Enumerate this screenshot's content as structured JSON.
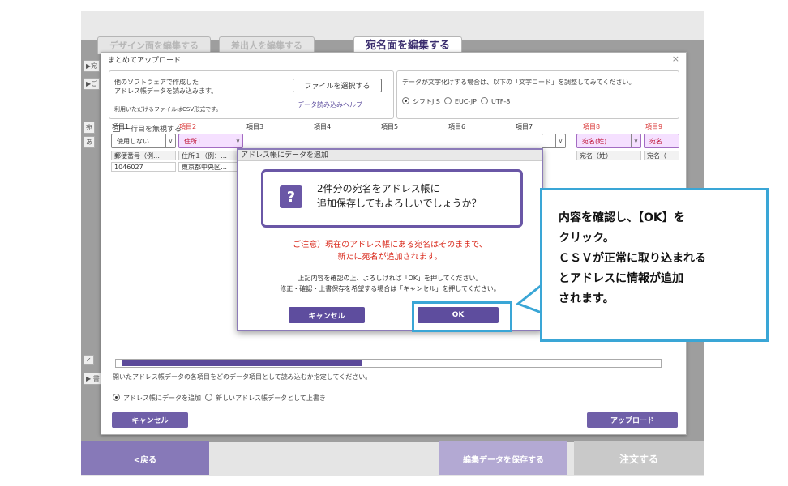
{
  "app": {
    "tabs": [
      "デザイン面を編集する",
      "差出人を編集する",
      "宛名面を編集する"
    ],
    "side_marks": [
      "▶宛",
      "▶ご",
      "宛",
      "あ",
      "✓ ",
      "▶ 書"
    ],
    "bottom": {
      "back": "<戻る",
      "save": "編集データを保存する",
      "order": "注文する"
    }
  },
  "dialog": {
    "title": "まとめてアップロード",
    "close": "×",
    "intro_lines": [
      "他のソフトウェアで作成した",
      "アドレス帳データを読み込みます。",
      "利用いただけるファイルはCSV形式です。"
    ],
    "file_button": "ファイルを選択する",
    "help_link": "データ読み込みヘルプ",
    "encoding_note": "データが文字化けする場合は、以下の「文字コード」を調整してみてください。",
    "encodings": [
      "シフトJIS",
      "EUC-JP",
      "UTF-8"
    ],
    "ignore_first_row": "一行目を無視する",
    "columns": [
      "項目1",
      "項目2",
      "項目3",
      "項目4",
      "項目5",
      "項目6",
      "項目7",
      "項目8",
      "項目9"
    ],
    "selects": [
      "使用しない",
      "住所1",
      "",
      "",
      "",
      "",
      "",
      "宛名(姓)",
      "宛名"
    ],
    "rows": [
      [
        "郵便番号（例…",
        "住所１（例：…",
        "宛名（姓）",
        "宛名（"
      ],
      [
        "1046027",
        "東京都中央区…",
        "",
        ""
      ]
    ],
    "mapping_note": "開いたアドレス帳データの各項目をどのデータ項目として読み込むか指定してください。",
    "mode_options": [
      "アドレス帳にデータを追加",
      "新しいアドレス帳データとして上書き"
    ],
    "cancel_label": "キャンセル",
    "upload_label": "アップロード"
  },
  "confirm": {
    "title": "アドレス帳にデータを追加",
    "icon_glyph": "?",
    "message_lines": [
      "2件分の宛名をアドレス帳に",
      "追加保存してもよろしいでしょうか？"
    ],
    "warning_lines": [
      "ご注意）現在のアドレス帳にある宛名はそのままで、",
      "新たに宛名が追加されます。"
    ],
    "note_lines": [
      "上記内容を確認の上、よろしければ「OK」を押してください。",
      "修正・確認・上書保存を希望する場合は「キャンセル」を押してください。"
    ],
    "cancel_label": "キャンセル",
    "ok_label": "OK"
  },
  "callout": {
    "lines": [
      "内容を確認し、【OK】を",
      "クリック。",
      "ＣＳＶが正常に取り込まれる",
      "とアドレスに情報が追加",
      "されます。"
    ],
    "color": "#3aa6d6"
  }
}
